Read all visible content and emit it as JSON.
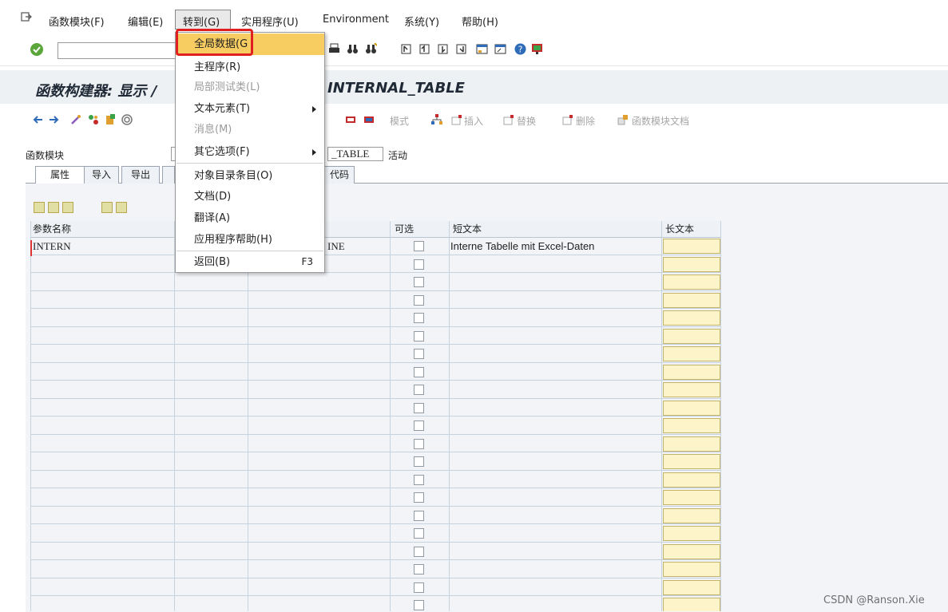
{
  "menubar": {
    "items": [
      {
        "label": "函数模块(F)"
      },
      {
        "label": "编辑(E)"
      },
      {
        "label": "转到(G)"
      },
      {
        "label": "实用程序(U)"
      },
      {
        "label": "Environment"
      },
      {
        "label": "系统(Y)"
      },
      {
        "label": "帮助(H)"
      }
    ]
  },
  "title": {
    "left": "函数构建器: 显示 /",
    "right": "INTERNAL_TABLE"
  },
  "app_toolbar": {
    "mode_label": "模式",
    "insert_label": "插入",
    "replace_label": "替换",
    "delete_label": "删除",
    "doc_label": "函数模块文档"
  },
  "header": {
    "function_module_label": "函数模块",
    "function_module_value": "_TABLE",
    "status": "活动"
  },
  "tabs": {
    "attributes": "属性",
    "import": "导入",
    "export": "导出",
    "source": "代码"
  },
  "table": {
    "headers": {
      "param_name": "参数名称",
      "optional": "可选",
      "short_text": "短文本",
      "long_text": "长文本"
    },
    "first_row": {
      "param_name": "INTERN",
      "type_ref": "INE",
      "short_text": "Interne Tabelle mit Excel-Daten"
    },
    "row_count": 21
  },
  "dropdown": {
    "items": [
      {
        "label": "全局数据(G",
        "state": "highlighted"
      },
      {
        "label": "主程序(R)",
        "state": "normal"
      },
      {
        "label": "局部测试类(L)",
        "state": "disabled"
      },
      {
        "label": "文本元素(T)",
        "state": "submenu"
      },
      {
        "label": "消息(M)",
        "state": "disabled"
      },
      {
        "label": "其它选项(F)",
        "state": "submenu"
      },
      {
        "label": "对象目录条目(O)",
        "state": "normal"
      },
      {
        "label": "文档(D)",
        "state": "normal"
      },
      {
        "label": "翻译(A)",
        "state": "normal"
      },
      {
        "label": "应用程序帮助(H)",
        "state": "normal"
      },
      {
        "label": "返回(B)",
        "state": "normal",
        "shortcut": "F3"
      }
    ]
  },
  "footer": {
    "watermark": "CSDN @Ranson.Xie"
  },
  "colors": {
    "highlight": "#f7cd62",
    "red_outline": "#e02020",
    "long_text_cell": "#fdf5c9"
  }
}
